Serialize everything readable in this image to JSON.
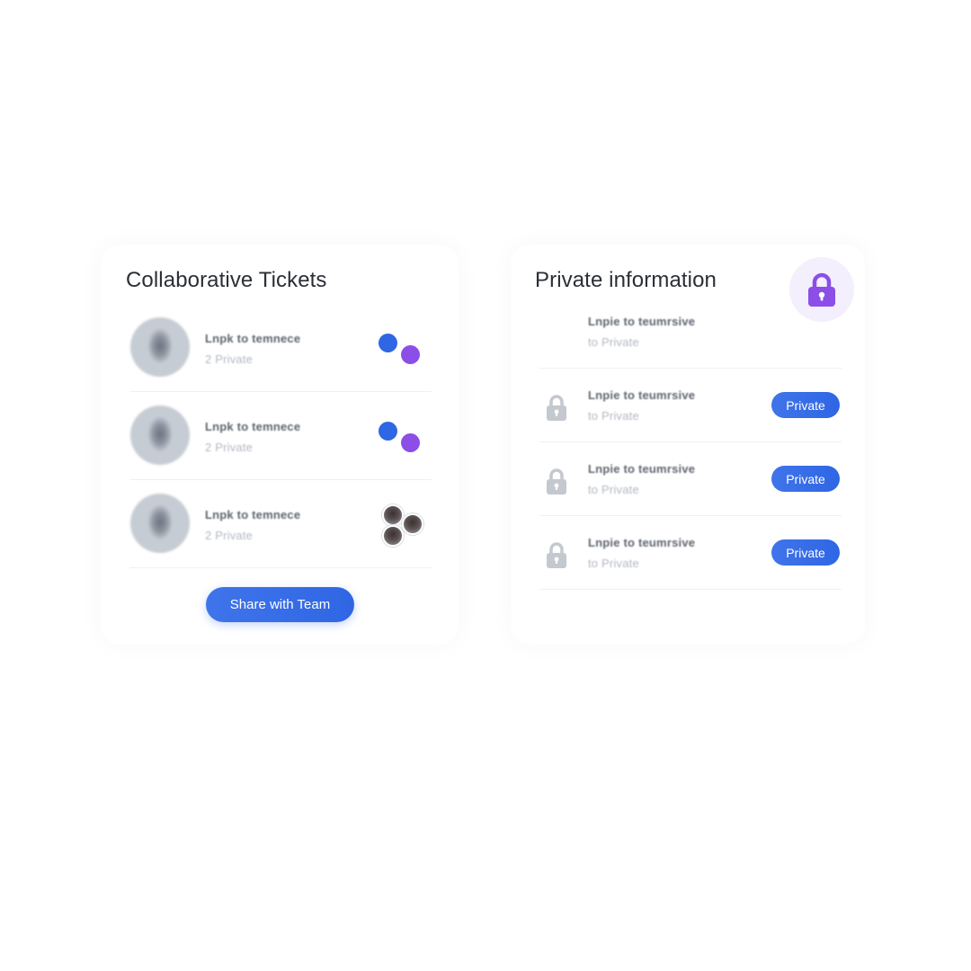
{
  "colors": {
    "accent_blue": "#2f66e4",
    "accent_purple": "#8b4ee6",
    "lock_gray": "#c4c8cf",
    "divider": "#eef0f3"
  },
  "collaborative": {
    "title": "Collaborative Tickets",
    "rows": [
      {
        "title": "Lnpk to temnece",
        "subtitle": "2 Private",
        "indicator": "blue-purple-dots"
      },
      {
        "title": "Lnpk to temnece",
        "subtitle": "2 Private",
        "indicator": "blue-purple-dots"
      },
      {
        "title": "Lnpk to temnece",
        "subtitle": "2 Private",
        "indicator": "avatar-group"
      }
    ],
    "share_button": "Share with Team"
  },
  "private": {
    "title": "Private information",
    "header_icon": "lock-icon",
    "rows": [
      {
        "title": "Lnpie to teumrsive",
        "subtitle": "to Private",
        "locked": false,
        "badge": ""
      },
      {
        "title": "Lnpie to teumrsive",
        "subtitle": "to Private",
        "locked": true,
        "badge": "Private"
      },
      {
        "title": "Lnpie to teumrsive",
        "subtitle": "to Private",
        "locked": true,
        "badge": "Private"
      },
      {
        "title": "Lnpie to teumrsive",
        "subtitle": "to Private",
        "locked": true,
        "badge": "Private"
      }
    ]
  }
}
